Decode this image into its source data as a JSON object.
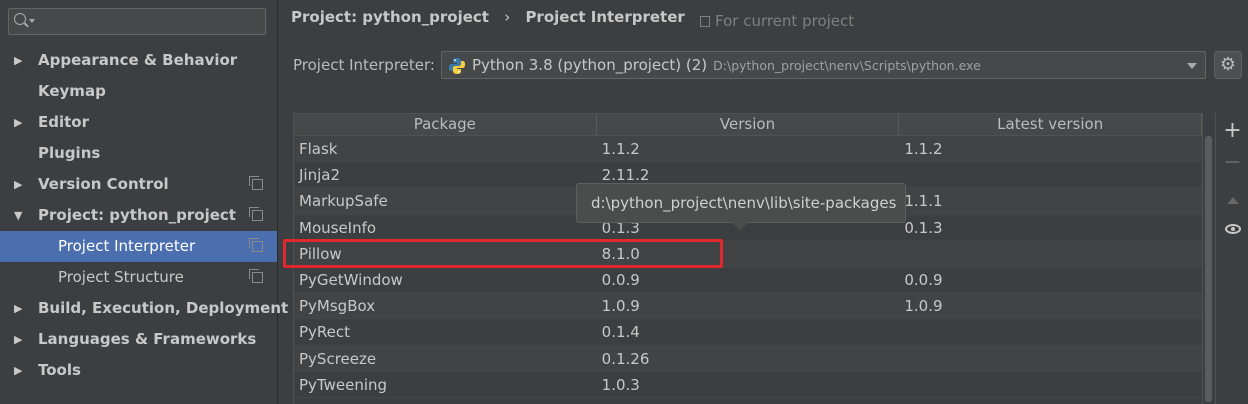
{
  "sidebar": {
    "search": {
      "value": "",
      "placeholder": ""
    },
    "items": [
      {
        "label": "Appearance & Behavior",
        "arrow": "▶"
      },
      {
        "label": "Keymap"
      },
      {
        "label": "Editor",
        "arrow": "▶"
      },
      {
        "label": "Plugins"
      },
      {
        "label": "Version Control",
        "arrow": "▶"
      },
      {
        "label": "Project: python_project",
        "arrow": "▼"
      },
      {
        "label": "Project Interpreter"
      },
      {
        "label": "Project Structure"
      },
      {
        "label": "Build, Execution, Deployment",
        "arrow": "▶"
      },
      {
        "label": "Languages & Frameworks",
        "arrow": "▶"
      },
      {
        "label": "Tools",
        "arrow": "▶"
      }
    ]
  },
  "header": {
    "breadcrumb_project": "Project: python_project",
    "breadcrumb_sep": "›",
    "breadcrumb_page": "Project Interpreter",
    "for_current_project": "For current project"
  },
  "interpreter": {
    "label": "Project Interpreter:",
    "name": "Python 3.8 (python_project) (2)",
    "path": "D:\\python_project\\nenv\\Scripts\\python.exe"
  },
  "table": {
    "headers": [
      "Package",
      "Version",
      "Latest version"
    ],
    "rows": [
      {
        "package": "Flask",
        "version": "1.1.2",
        "latest": "1.1.2"
      },
      {
        "package": "Jinja2",
        "version": "2.11.2",
        "latest": ""
      },
      {
        "package": "MarkupSafe",
        "version": "",
        "latest": "1.1.1"
      },
      {
        "package": "MouseInfo",
        "version": "0.1.3",
        "latest": "0.1.3"
      },
      {
        "package": "Pillow",
        "version": "8.1.0",
        "latest": ""
      },
      {
        "package": "PyGetWindow",
        "version": "0.0.9",
        "latest": "0.0.9"
      },
      {
        "package": "PyMsgBox",
        "version": "1.0.9",
        "latest": "1.0.9"
      },
      {
        "package": "PyRect",
        "version": "0.1.4",
        "latest": ""
      },
      {
        "package": "PyScreeze",
        "version": "0.1.26",
        "latest": ""
      },
      {
        "package": "PyTweening",
        "version": "1.0.3",
        "latest": ""
      }
    ]
  },
  "tooltip": {
    "text": "d:\\python_project\\nenv\\lib\\site-packages"
  },
  "toolbar": {
    "add": "+",
    "remove": "−",
    "gear": "⚙"
  },
  "colors": {
    "selection": "#4b6eaf",
    "highlight": "#e0282e",
    "background": "#3c3f41"
  }
}
